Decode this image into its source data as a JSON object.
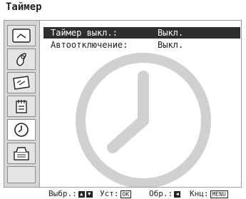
{
  "window": {
    "title": "Таймер"
  },
  "sidebar": {
    "items": [
      {
        "icon": "picture-icon",
        "active": false
      },
      {
        "icon": "sound-icon",
        "active": false
      },
      {
        "icon": "screen-icon",
        "active": false
      },
      {
        "icon": "settings-icon",
        "active": false
      },
      {
        "icon": "clock-icon",
        "active": true
      },
      {
        "icon": "setup-icon",
        "active": false
      }
    ]
  },
  "menu": {
    "rows": [
      {
        "label": "Таймер выкл.:",
        "value": "Выкл.",
        "selected": true
      },
      {
        "label": "Автоотключение:",
        "value": "Выкл.",
        "selected": false
      }
    ]
  },
  "footer": {
    "select_label": "Выбр.:",
    "confirm_label": "Уст:",
    "confirm_key": "OK",
    "back_label": "Обр.:",
    "exit_label": "Кнц:",
    "exit_key": "MENU"
  },
  "colors": {
    "selected_row": "#2e2e2e",
    "sidebar": "#d6d6d6",
    "watermark": "#d0d0d0"
  }
}
